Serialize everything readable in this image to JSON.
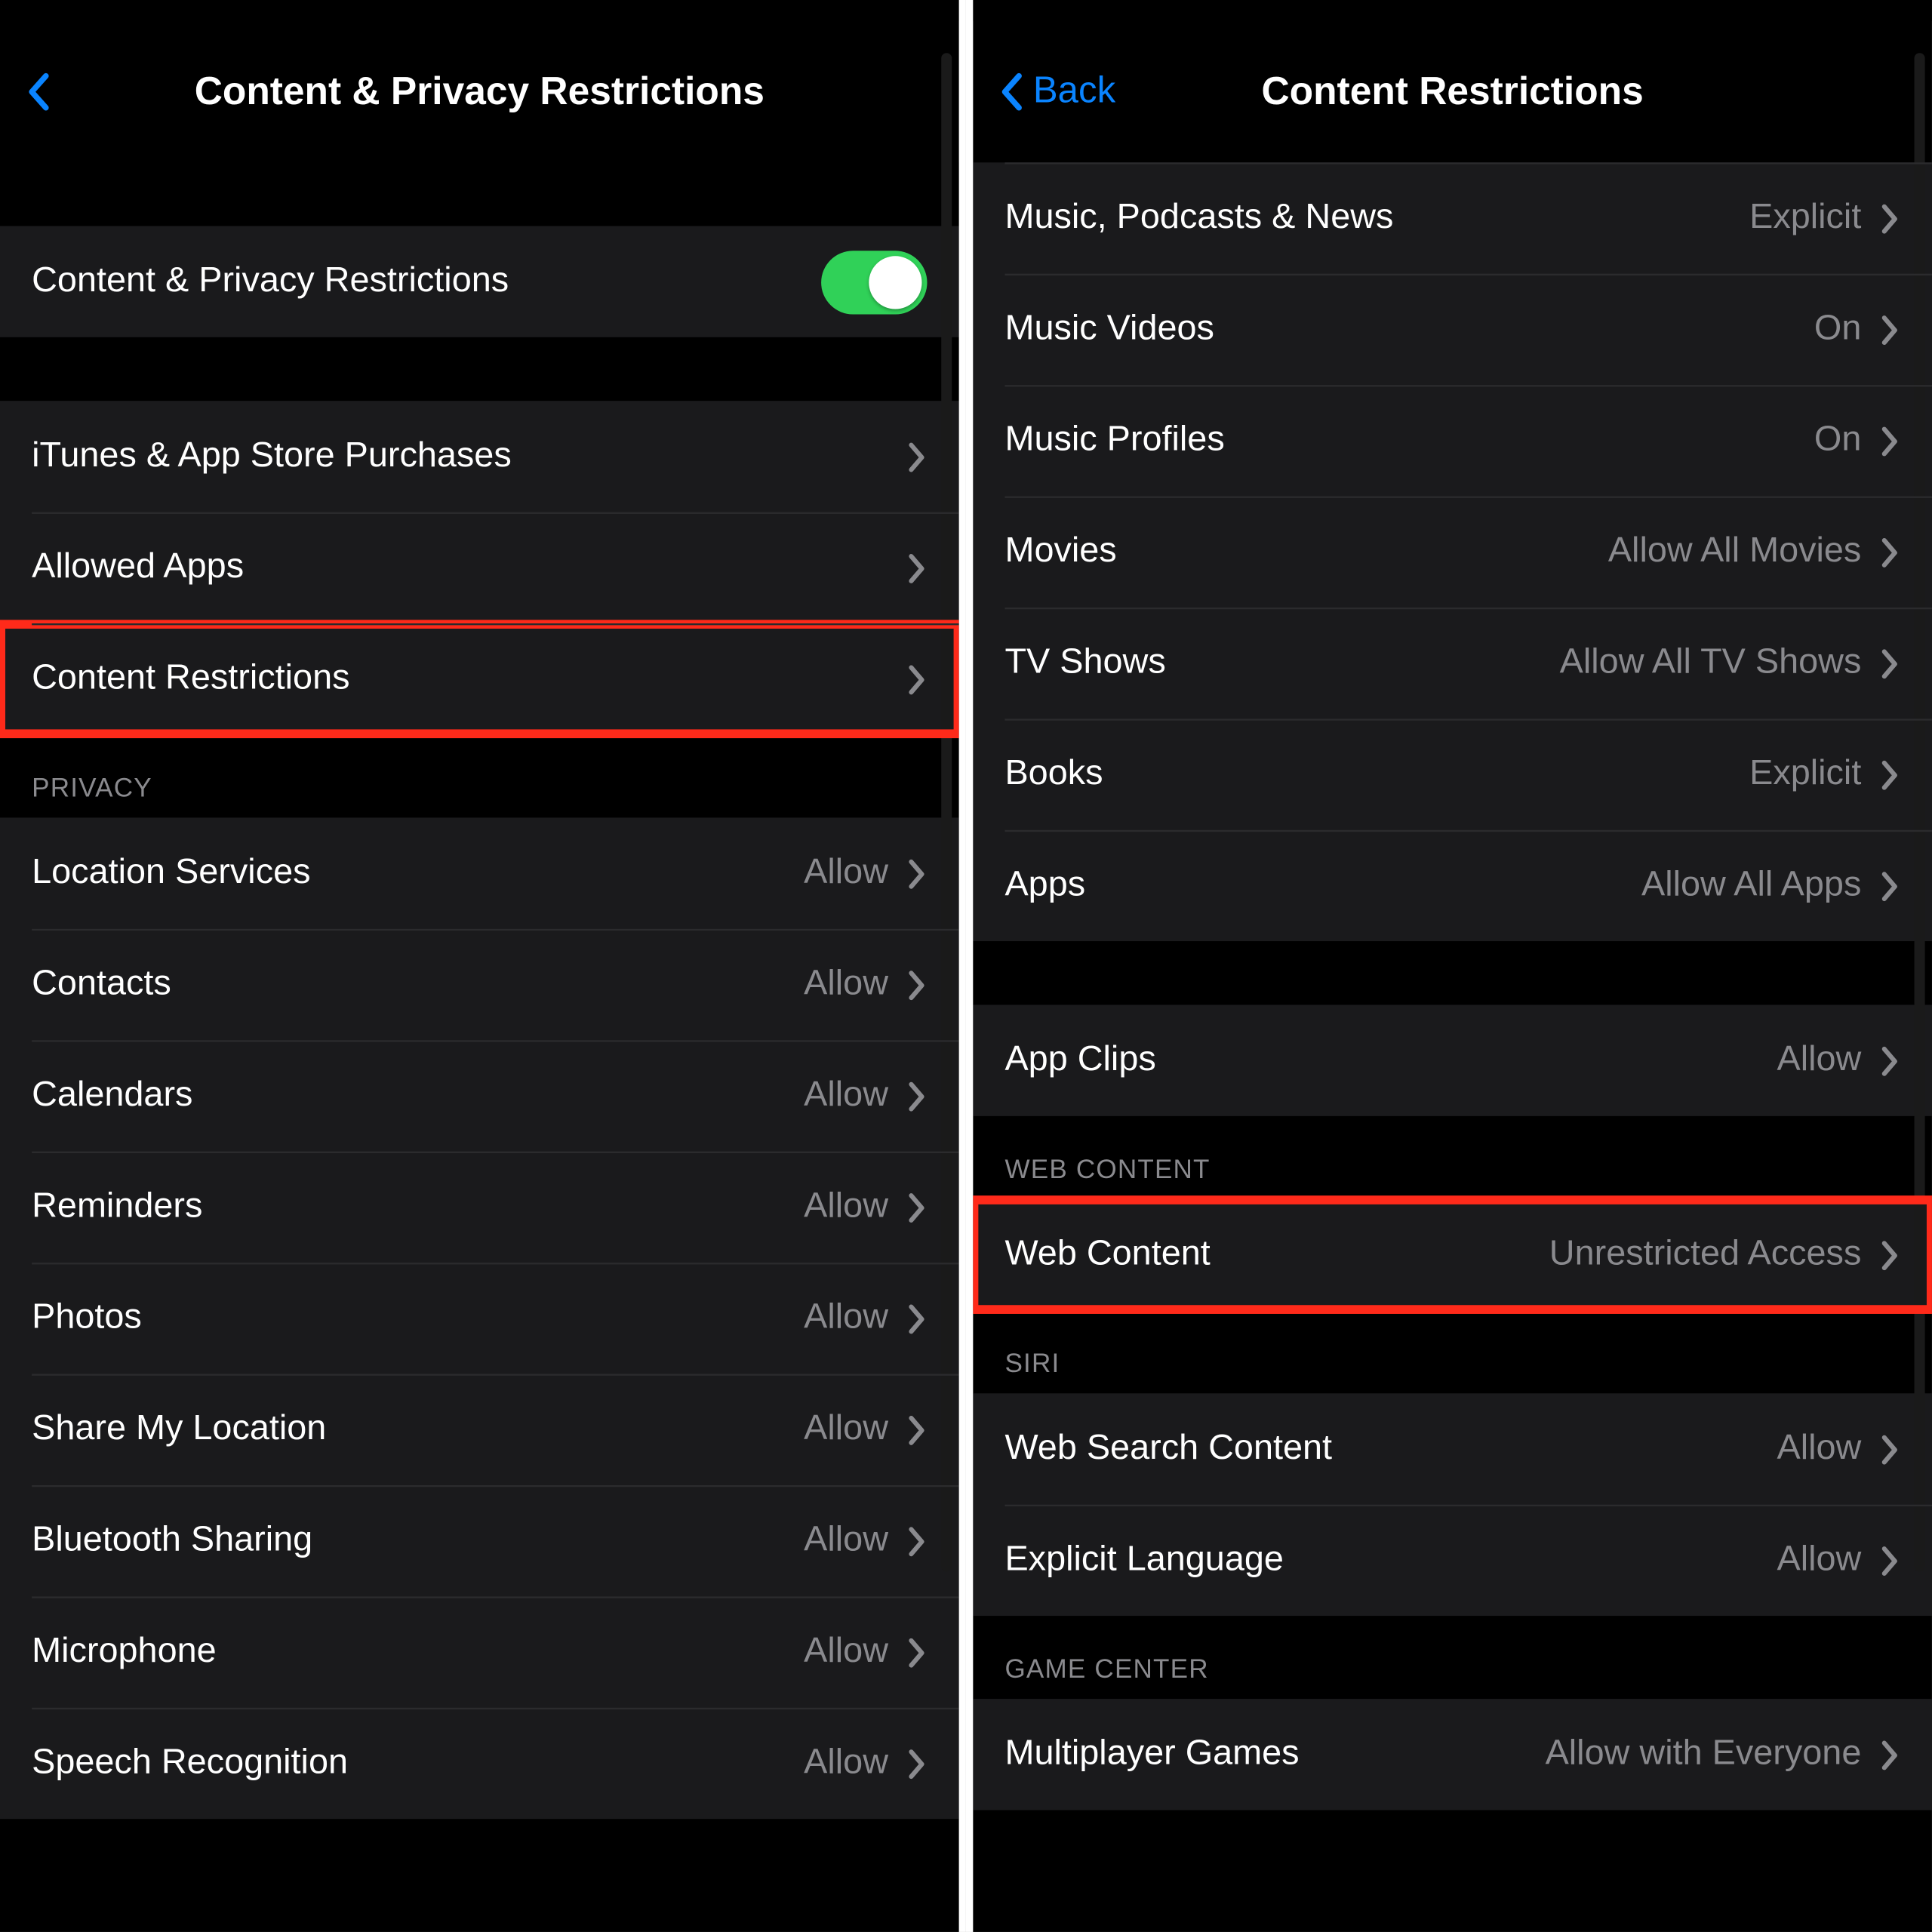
{
  "left": {
    "title": "Content & Privacy Restrictions",
    "toggle_label": "Content & Privacy Restrictions",
    "group1": [
      {
        "label": "iTunes & App Store Purchases"
      },
      {
        "label": "Allowed Apps"
      },
      {
        "label": "Content Restrictions",
        "highlighted": true
      }
    ],
    "privacy_header": "PRIVACY",
    "privacy": [
      {
        "label": "Location Services",
        "value": "Allow"
      },
      {
        "label": "Contacts",
        "value": "Allow"
      },
      {
        "label": "Calendars",
        "value": "Allow"
      },
      {
        "label": "Reminders",
        "value": "Allow"
      },
      {
        "label": "Photos",
        "value": "Allow"
      },
      {
        "label": "Share My Location",
        "value": "Allow"
      },
      {
        "label": "Bluetooth Sharing",
        "value": "Allow"
      },
      {
        "label": "Microphone",
        "value": "Allow"
      },
      {
        "label": "Speech Recognition",
        "value": "Allow"
      }
    ]
  },
  "right": {
    "back_label": "Back",
    "title": "Content Restrictions",
    "group1": [
      {
        "label": "Music, Podcasts & News",
        "value": "Explicit"
      },
      {
        "label": "Music Videos",
        "value": "On"
      },
      {
        "label": "Music Profiles",
        "value": "On"
      },
      {
        "label": "Movies",
        "value": "Allow All Movies"
      },
      {
        "label": "TV Shows",
        "value": "Allow All TV Shows"
      },
      {
        "label": "Books",
        "value": "Explicit"
      },
      {
        "label": "Apps",
        "value": "Allow All Apps"
      }
    ],
    "group2": [
      {
        "label": "App Clips",
        "value": "Allow"
      }
    ],
    "web_header": "WEB CONTENT",
    "web": [
      {
        "label": "Web Content",
        "value": "Unrestricted Access",
        "highlighted": true
      }
    ],
    "siri_header": "SIRI",
    "siri": [
      {
        "label": "Web Search Content",
        "value": "Allow"
      },
      {
        "label": "Explicit Language",
        "value": "Allow"
      }
    ],
    "gc_header": "GAME CENTER",
    "gc": [
      {
        "label": "Multiplayer Games",
        "value": "Allow with Everyone"
      }
    ]
  }
}
